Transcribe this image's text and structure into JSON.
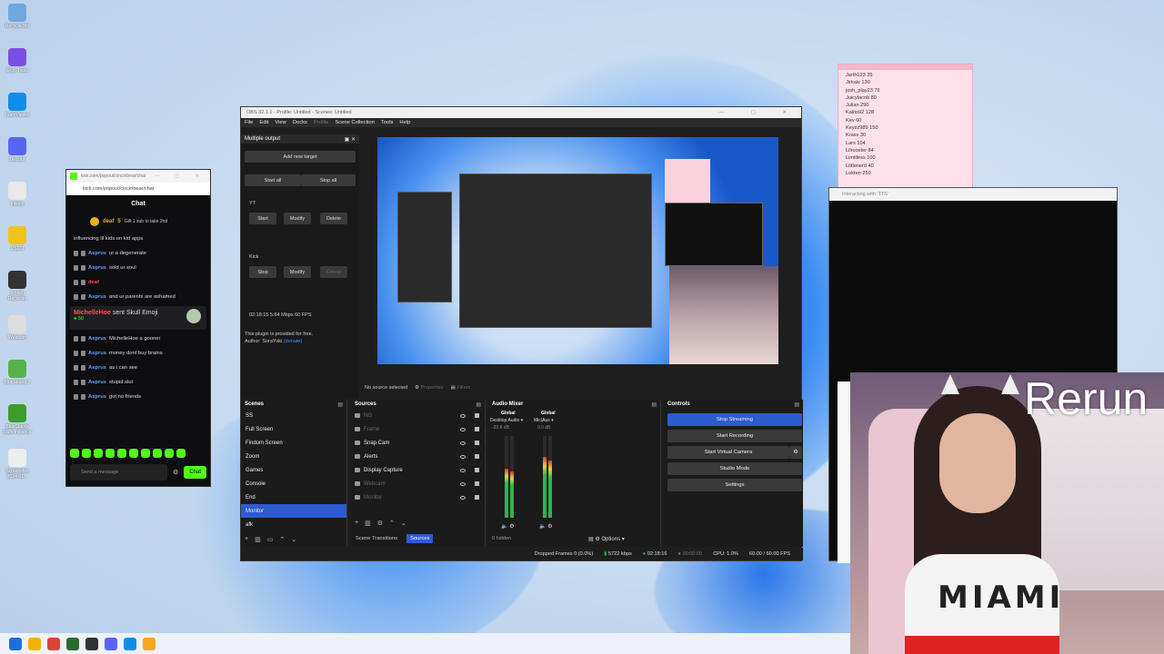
{
  "desktop": {
    "icons": [
      {
        "label": "Recycle Bin",
        "color": "#6fa8dc"
      },
      {
        "label": "Ergo Tools",
        "color": "#7b4fe0"
      },
      {
        "label": "TeamViewer",
        "color": "#0e8ee9"
      },
      {
        "label": "Discord",
        "color": "#5865f2"
      },
      {
        "label": "Infinity",
        "color": "#e8e8e8"
      },
      {
        "label": "VSCO",
        "color": "#f0c419"
      },
      {
        "label": "Screen Recorder",
        "color": "#333333"
      },
      {
        "label": "Webcam",
        "color": "#dddddd"
      },
      {
        "label": "BlueStacks 5",
        "color": "#56b24a"
      },
      {
        "label": "BlueStacks Multi-Instance",
        "color": "#3c9c2f"
      },
      {
        "label": "Screenshot 2024-01...",
        "color": "#eeeeee"
      }
    ]
  },
  "kick": {
    "window_title": "kick.com/popout/cincinbear/chat",
    "url": "kick.com/popout/cincinbear/chat",
    "header": "Chat",
    "gift": {
      "user": "deaf",
      "count": "5",
      "text": "Gift 1 sub to take 2nd"
    },
    "messages": [
      {
        "user": "",
        "text": "influencing lil kids on kid apps"
      },
      {
        "user": "Asprus",
        "text": "ur a degenerate"
      },
      {
        "user": "Asprus",
        "text": "sold ur soul"
      },
      {
        "user": "deaf",
        "text": ""
      },
      {
        "user": "Asprus",
        "text": "and ur parents are ashamed"
      }
    ],
    "highlight": {
      "user": "MichelleHoe",
      "text": "sent Skull Emoji",
      "points": "50"
    },
    "messages2": [
      {
        "user": "Asprus",
        "text": "MichelleHoe a gooner"
      },
      {
        "user": "Asprus",
        "text": "money dont buy brains"
      },
      {
        "user": "Asprus",
        "text": "as i can see"
      },
      {
        "user": "Asprus",
        "text": "stupid slut"
      },
      {
        "user": "Asprus",
        "text": "got no friends"
      }
    ],
    "send_placeholder": "Send a message",
    "chat_button": "Chat",
    "accent": "#53fc18"
  },
  "obs": {
    "title": "OBS 32.1.1 - Profile: Untitled - Scenes: Untitled",
    "menu": [
      "File",
      "Edit",
      "View",
      "Docks",
      "Profile",
      "Scene Collection",
      "Tools",
      "Help"
    ],
    "multiple_output": {
      "title": "Multiple output",
      "add_target": "Add new target",
      "start_all": "Start all",
      "stop_all": "Stop all",
      "yt_label": "YT",
      "yt_start": "Start",
      "yt_modify": "Modify",
      "yt_delete": "Delete",
      "kick_label": "Kick",
      "kick_stop": "Stop",
      "kick_modify": "Modify",
      "kick_delete": "Delete",
      "stats": "02:18:15  5.64 Mbps  60 FPS",
      "note_line1": "This plugin is provided for free.",
      "note_line2": "Author: SoraYuki",
      "note_link": "(donate)"
    },
    "source_bar": {
      "selected": "No source selected",
      "properties": "Properties",
      "filters": "Filters"
    },
    "scenes": {
      "title": "Scenes",
      "items": [
        "SS",
        "Full Screen",
        "Findom Screen",
        "Zoom",
        "Games",
        "Console",
        "End",
        "Monitor",
        "afk"
      ],
      "selected": "Monitor"
    },
    "sources": {
      "title": "Sources",
      "items": [
        {
          "name": "NG",
          "dim": true
        },
        {
          "name": "Frame",
          "dim": true
        },
        {
          "name": "Snap Cam",
          "dim": false
        },
        {
          "name": "Alerts",
          "dim": false
        },
        {
          "name": "Display Capture",
          "dim": false
        },
        {
          "name": "Webcam",
          "dim": true
        },
        {
          "name": "Monitor",
          "dim": true
        }
      ]
    },
    "tabs": {
      "transitions": "Scene Transitions",
      "sources": "Sources"
    },
    "mixer": {
      "title": "Audio Mixer",
      "ch1": "Desktop Audio",
      "ch2": "Mic/Aux",
      "global": "Global",
      "db1": "-20.8 dB",
      "db2": "0.0 dB",
      "level1": 0.6,
      "level2": 0.75,
      "hidden": "0 hidden",
      "options": "Options"
    },
    "controls": {
      "title": "Controls",
      "stop_streaming": "Stop Streaming",
      "start_recording": "Start Recording",
      "start_vcam": "Start Virtual Camera",
      "studio_mode": "Studio Mode",
      "settings": "Settings"
    },
    "status": {
      "dropped": "Dropped Frames 0 (0.0%)",
      "kbps": "5722 kbps",
      "live": "02:18:16",
      "rec": "00:00:00",
      "cpu": "CPU: 1.0%",
      "fps": "60.00 / 60.00 FPS"
    }
  },
  "notepad": {
    "lines": [
      "Jarth123 35",
      "Jirkaiv 130",
      "josh_play23 76",
      "Juicylacob 80",
      "Julian 290",
      "Kalito92 128",
      "Kev 60",
      "Keyzz989 150",
      "Krass 30",
      "Lars 104",
      "Lilrooster 84",
      "Limitless 100",
      "Littlenerd 40",
      "Lokten 250"
    ]
  },
  "dark_window": {
    "title": "Interacting with 'TTS'"
  },
  "overlay": {
    "text": "Rerun",
    "shirt": "MIAMI"
  },
  "taskbar": {
    "icons": [
      {
        "name": "start-icon",
        "color": "#1e6fd9"
      },
      {
        "name": "explorer-icon",
        "color": "#f0b400"
      },
      {
        "name": "chrome-icon",
        "color": "#db4437"
      },
      {
        "name": "xbox-icon",
        "color": "#2b6a2b"
      },
      {
        "name": "obs-icon",
        "color": "#333333"
      },
      {
        "name": "discord-icon",
        "color": "#5865f2"
      },
      {
        "name": "teamviewer-icon",
        "color": "#0e8ee9"
      },
      {
        "name": "app-icon",
        "color": "#f5a623"
      }
    ]
  }
}
